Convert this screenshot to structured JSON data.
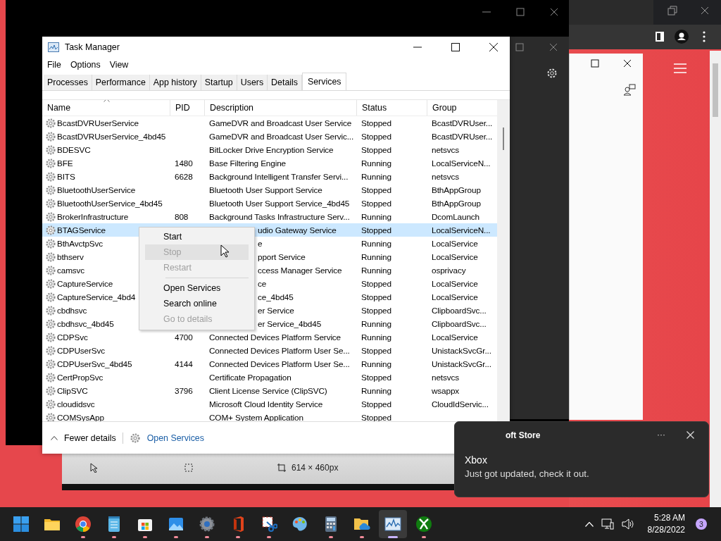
{
  "task_manager": {
    "title": "Task Manager",
    "menu": [
      "File",
      "Options",
      "View"
    ],
    "tabs": [
      {
        "label": "Processes",
        "selected": false
      },
      {
        "label": "Performance",
        "selected": false
      },
      {
        "label": "App history",
        "selected": false
      },
      {
        "label": "Startup",
        "selected": false
      },
      {
        "label": "Users",
        "selected": false
      },
      {
        "label": "Details",
        "selected": false
      },
      {
        "label": "Services",
        "selected": true
      }
    ],
    "columns": [
      "Name",
      "PID",
      "Description",
      "Status",
      "Group"
    ],
    "rows": [
      {
        "name": "BcastDVRUserService",
        "description": "GameDVR and Broadcast User Service",
        "status": "Stopped",
        "group": "BcastDVRUser...",
        "selected": false
      },
      {
        "name": "BcastDVRUserService_4bd45",
        "description": "GameDVR and Broadcast User Servic...",
        "status": "Stopped",
        "group": "BcastDVRUser...",
        "selected": false
      },
      {
        "name": "BDESVC",
        "description": "BitLocker Drive Encryption Service",
        "status": "Stopped",
        "group": "netsvcs",
        "selected": false
      },
      {
        "name": "BFE",
        "pid": "1480",
        "description": "Base Filtering Engine",
        "status": "Running",
        "group": "LocalServiceN...",
        "selected": false
      },
      {
        "name": "BITS",
        "pid": "6628",
        "description": "Background Intelligent Transfer Servi...",
        "status": "Running",
        "group": "netsvcs",
        "selected": false
      },
      {
        "name": "BluetoothUserService",
        "description": "Bluetooth User Support Service",
        "status": "Stopped",
        "group": "BthAppGroup",
        "selected": false
      },
      {
        "name": "BluetoothUserService_4bd45",
        "description": "Bluetooth User Support Service_4bd45",
        "status": "Stopped",
        "group": "BthAppGroup",
        "selected": false
      },
      {
        "name": "BrokerInfrastructure",
        "pid": "808",
        "description": "Background Tasks Infrastructure Serv...",
        "status": "Running",
        "group": "DcomLaunch",
        "selected": false
      },
      {
        "name": "BTAGService",
        "description_tail": "udio Gateway Service",
        "status": "Stopped",
        "group": "LocalServiceN...",
        "selected": true
      },
      {
        "name": "BthAvctpSvc",
        "description_tail": "e",
        "status": "Running",
        "group": "LocalService",
        "selected": false
      },
      {
        "name": "bthserv",
        "description_tail": "pport Service",
        "status": "Running",
        "group": "LocalService",
        "selected": false
      },
      {
        "name": "camsvc",
        "description_tail": "ccess Manager Service",
        "status": "Running",
        "group": "osprivacy",
        "selected": false
      },
      {
        "name": "CaptureService",
        "description_tail": "ce",
        "status": "Stopped",
        "group": "LocalService",
        "selected": false
      },
      {
        "name": "CaptureService_4bd4",
        "description_tail": "ce_4bd45",
        "status": "Stopped",
        "group": "LocalService",
        "selected": false
      },
      {
        "name": "cbdhsvc",
        "description_tail": "er Service",
        "status": "Stopped",
        "group": "ClipboardSvc...",
        "selected": false
      },
      {
        "name": "cbdhsvc_4bd45",
        "description_tail": "er Service_4bd45",
        "status": "Running",
        "group": "ClipboardSvc...",
        "selected": false
      },
      {
        "name": "CDPSvc",
        "pid": "4700",
        "description": "Connected Devices Platform Service",
        "status": "Running",
        "group": "LocalService",
        "selected": false
      },
      {
        "name": "CDPUserSvc",
        "description": "Connected Devices Platform User Se...",
        "status": "Stopped",
        "group": "UnistackSvcGr...",
        "selected": false
      },
      {
        "name": "CDPUserSvc_4bd45",
        "pid": "4144",
        "description": "Connected Devices Platform User Se...",
        "status": "Running",
        "group": "UnistackSvcGr...",
        "selected": false
      },
      {
        "name": "CertPropSvc",
        "description": "Certificate Propagation",
        "status": "Stopped",
        "group": "netsvcs",
        "selected": false
      },
      {
        "name": "ClipSVC",
        "pid": "3796",
        "description": "Client License Service (ClipSVC)",
        "status": "Running",
        "group": "wsappx",
        "selected": false
      },
      {
        "name": "cloudidsvc",
        "description": "Microsoft Cloud Identity Service",
        "status": "Stopped",
        "group": "CloudIdServic...",
        "selected": false
      },
      {
        "name": "COMSysApp",
        "description": "COM+ System Application",
        "status": "Stopped",
        "selected": false
      }
    ],
    "context_menu": [
      {
        "kind": "item",
        "label": "Start",
        "disabled": false,
        "hovered": false
      },
      {
        "kind": "item",
        "label": "Stop",
        "disabled": true,
        "hovered": true
      },
      {
        "kind": "item",
        "label": "Restart",
        "disabled": true,
        "hovered": false
      },
      {
        "kind": "separator"
      },
      {
        "kind": "item",
        "label": "Open Services",
        "disabled": false,
        "hovered": false
      },
      {
        "kind": "item",
        "label": "Search online",
        "disabled": false,
        "hovered": false
      },
      {
        "kind": "item",
        "label": "Go to details",
        "disabled": true,
        "hovered": false
      }
    ],
    "footer": {
      "fewer_details": "Fewer details",
      "open_services": "Open Services"
    }
  },
  "snipping_toolbar": {
    "size": "614 × 460px"
  },
  "notification": {
    "app": "oft Store",
    "more": "···",
    "title": "Xbox",
    "body": "Just got updated, check it out."
  },
  "taskbar": {
    "apps": [
      {
        "kind": "start",
        "running": false,
        "active": false
      },
      {
        "kind": "folder",
        "running": false,
        "active": false
      },
      {
        "kind": "browser",
        "running": true,
        "active": false
      },
      {
        "kind": "notepad",
        "running": true,
        "active": false
      },
      {
        "kind": "store",
        "running": true,
        "active": false
      },
      {
        "kind": "photos",
        "running": true,
        "active": false
      },
      {
        "kind": "settings",
        "running": true,
        "active": false
      },
      {
        "kind": "office",
        "running": true,
        "active": false
      },
      {
        "kind": "snip",
        "running": true,
        "active": false
      },
      {
        "kind": "paint",
        "running": false,
        "active": false
      },
      {
        "kind": "calculator",
        "running": true,
        "active": false
      },
      {
        "kind": "cloudfolder",
        "running": true,
        "active": false
      },
      {
        "kind": "taskmanager",
        "running": true,
        "active": true
      },
      {
        "kind": "xbox",
        "running": true,
        "active": false
      }
    ],
    "time": "5:28 AM",
    "date": "8/28/2022",
    "badge": "3"
  }
}
